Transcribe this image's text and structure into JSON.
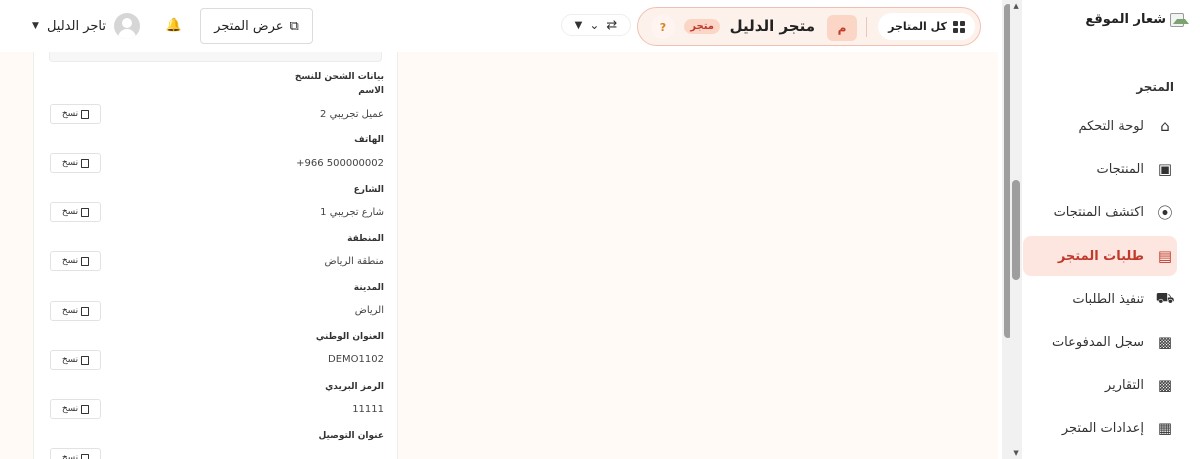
{
  "sidebar": {
    "brand_alt": "شعار الموقع",
    "section_title": "المتجر",
    "items": [
      {
        "label": "لوحة التحكم",
        "icon": "home-icon"
      },
      {
        "label": "المنتجات",
        "icon": "box-icon"
      },
      {
        "label": "اكتشف المنتجات",
        "icon": "compass-icon"
      },
      {
        "label": "طلبات المتجر",
        "icon": "receipt-icon",
        "active": true
      },
      {
        "label": "تنفيذ الطلبات",
        "icon": "truck-icon"
      },
      {
        "label": "سجل المدفوعات",
        "icon": "money-icon"
      },
      {
        "label": "التقارير",
        "icon": "chart-icon"
      },
      {
        "label": "إعدادات المتجر",
        "icon": "store-icon"
      }
    ]
  },
  "header": {
    "all_stores_label": "كل المتاجر",
    "store_avatar_letter": "م",
    "store_name": "متجر الدليل",
    "store_badge": "متجر",
    "help_label": "?",
    "view_store_label": "عرض المتجر",
    "user_name": "تاجر الدليل"
  },
  "card": {
    "heading": "بيانات الشحن للنسخ",
    "copy_label": "نسخ",
    "fields": [
      {
        "label": "الاسم",
        "value": "عميل تجريبي 2"
      },
      {
        "label": "الهاتف",
        "value": "+966 500000002"
      },
      {
        "label": "الشارع",
        "value": "شارع تجريبي 1"
      },
      {
        "label": "المنطقة",
        "value": "منطقة الرياض"
      },
      {
        "label": "المدينة",
        "value": "الرياض"
      },
      {
        "label": "العنوان الوطني",
        "value": "DEMO1102"
      },
      {
        "label": "الرمز البريدي",
        "value": "11111"
      },
      {
        "label": "عنوان التوصيل",
        "value": ""
      }
    ]
  },
  "colors": {
    "accent": "#c0392b",
    "accent_bg": "#fde6df",
    "pill_bg": "#fdf1ec",
    "pill_border": "#f2c0b2",
    "content_bg": "#fffaf5"
  }
}
